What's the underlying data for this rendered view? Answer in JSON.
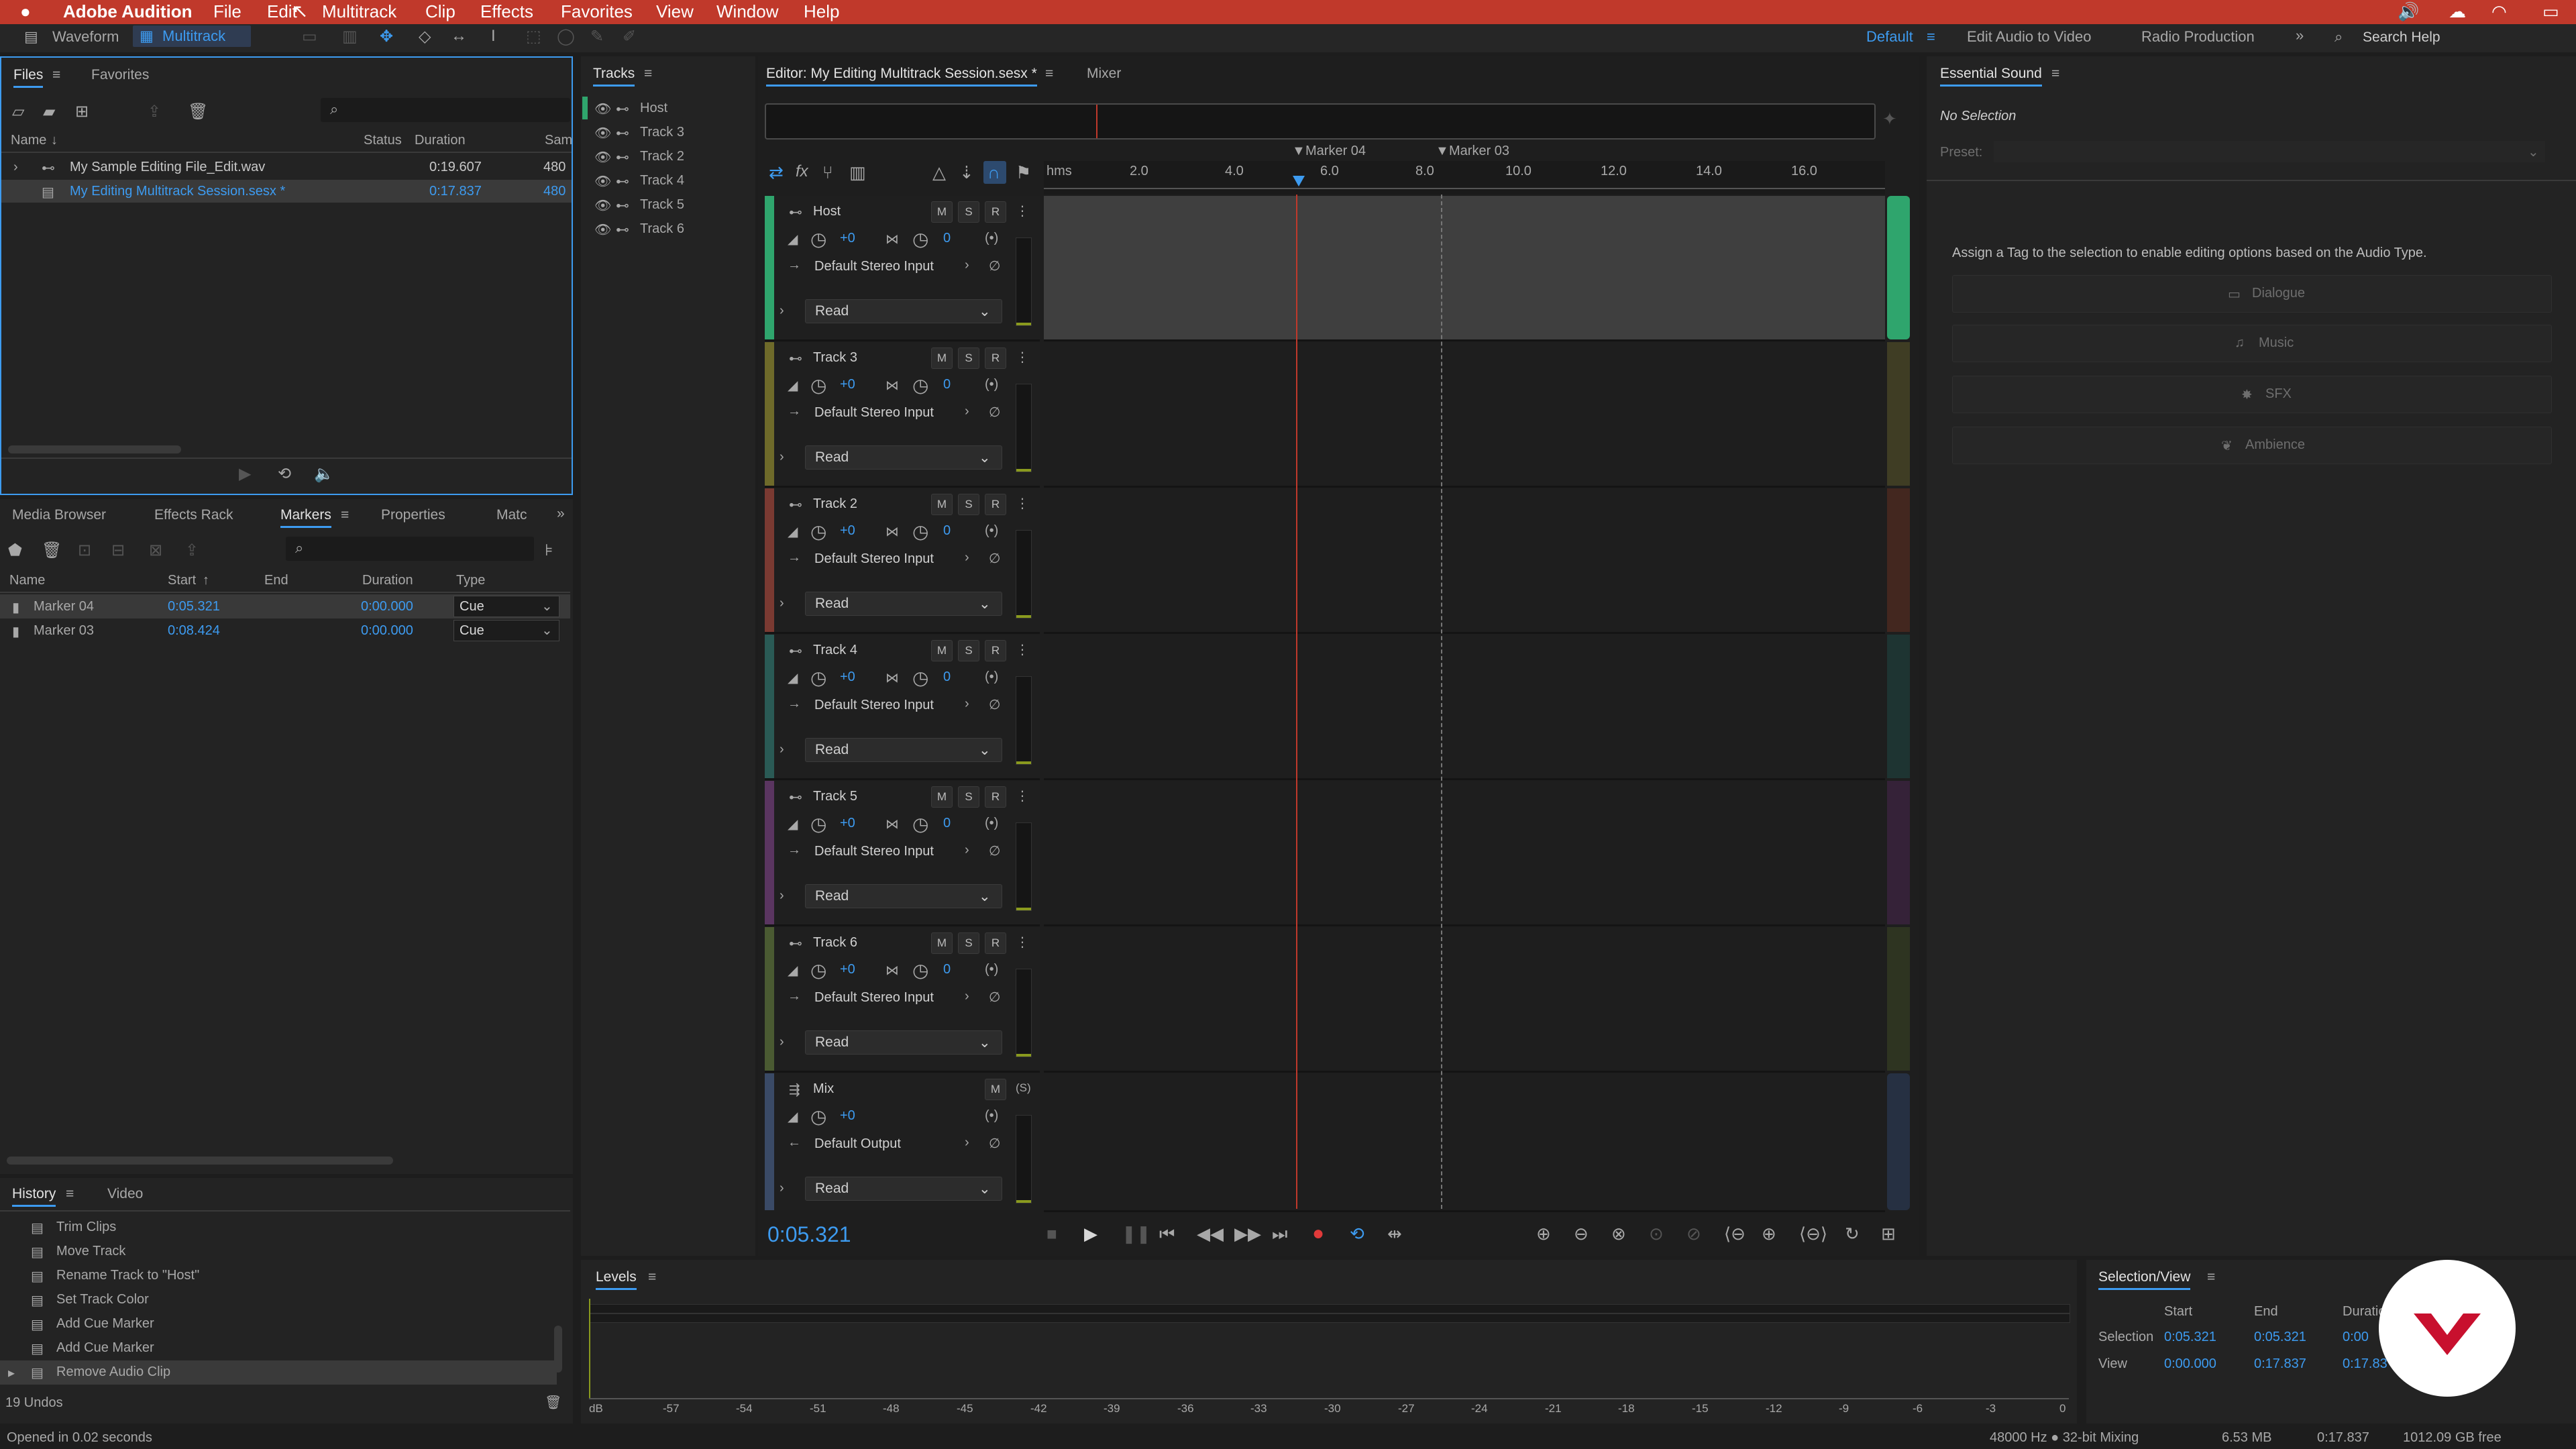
{
  "menubar": {
    "apple": "",
    "app_name": "Adobe Audition",
    "items": [
      "File",
      "Edit",
      "Multitrack",
      "Clip",
      "Effects",
      "Favorites",
      "View",
      "Window",
      "Help"
    ]
  },
  "workspace_bar": {
    "view_tabs": [
      "Waveform",
      "Multitrack"
    ],
    "workspaces": [
      "Default",
      "Edit Audio to Video",
      "Radio Production"
    ],
    "search_placeholder": "Search Help"
  },
  "files_panel": {
    "tabs": [
      "Files",
      "Favorites"
    ],
    "columns": [
      "Name",
      "Status",
      "Duration",
      "Sam"
    ],
    "rows": [
      {
        "name": "My Sample Editing File_Edit.wav",
        "status": "",
        "duration": "0:19.607",
        "rate": "480"
      },
      {
        "name": "My Editing Multitrack Session.sesx *",
        "status": "",
        "duration": "0:17.837",
        "rate": "480"
      }
    ]
  },
  "markers_panel": {
    "tabs": [
      "Media Browser",
      "Effects Rack",
      "Markers",
      "Properties",
      "Matc"
    ],
    "columns": [
      "Name",
      "Start",
      "End",
      "Duration",
      "Type"
    ],
    "rows": [
      {
        "name": "Marker 04",
        "start": "0:05.321",
        "end": "",
        "duration": "0:00.000",
        "type": "Cue"
      },
      {
        "name": "Marker 03",
        "start": "0:08.424",
        "end": "",
        "duration": "0:00.000",
        "type": "Cue"
      }
    ]
  },
  "history_panel": {
    "tabs": [
      "History",
      "Video"
    ],
    "items": [
      "Trim Clips",
      "Move Track",
      "Rename Track to \"Host\"",
      "Set Track Color",
      "Add Cue Marker",
      "Add Cue Marker",
      "Remove Audio Clip"
    ],
    "undos": "19 Undos"
  },
  "status_bar": {
    "message": "Opened in 0.02 seconds",
    "sample_info": "48000 Hz ● 32-bit Mixing",
    "mem": "6.53 MB",
    "duration": "0:17.837",
    "free": "1012.09 GB free"
  },
  "tracks_panel": {
    "title": "Tracks",
    "items": [
      "Host",
      "Track 3",
      "Track 2",
      "Track 4",
      "Track 5",
      "Track 6"
    ]
  },
  "editor": {
    "tabs": [
      "Editor: My Editing Multitrack Session.sesx *",
      "Mixer"
    ],
    "ruler_unit": "hms",
    "ruler_ticks": [
      "2.0",
      "4.0",
      "6.0",
      "8.0",
      "10.0",
      "12.0",
      "14.0",
      "16.0"
    ],
    "markers": [
      "Marker 04",
      "Marker 03"
    ],
    "time": "0:05.321",
    "tracks": [
      {
        "name": "Host",
        "vol": "+0",
        "pan": "0",
        "input": "Default Stereo Input",
        "mode": "Read",
        "color": "#2fa56d"
      },
      {
        "name": "Track 3",
        "vol": "+0",
        "pan": "0",
        "input": "Default Stereo Input",
        "mode": "Read",
        "color": "#6e6a2a"
      },
      {
        "name": "Track 2",
        "vol": "+0",
        "pan": "0",
        "input": "Default Stereo Input",
        "mode": "Read",
        "color": "#7a3a32"
      },
      {
        "name": "Track 4",
        "vol": "+0",
        "pan": "0",
        "input": "Default Stereo Input",
        "mode": "Read",
        "color": "#2a5a55"
      },
      {
        "name": "Track 5",
        "vol": "+0",
        "pan": "0",
        "input": "Default Stereo Input",
        "mode": "Read",
        "color": "#5a3560"
      },
      {
        "name": "Track 6",
        "vol": "+0",
        "pan": "0",
        "input": "Default Stereo Input",
        "mode": "Read",
        "color": "#4a5a32"
      }
    ],
    "mix": {
      "name": "Mix",
      "vol": "+0",
      "output": "Default Output",
      "mode": "Read",
      "color": "#3a4a66"
    },
    "btn_m": "M",
    "btn_s": "S",
    "btn_r": "R"
  },
  "levels_panel": {
    "title": "Levels",
    "scale": [
      "dB",
      "-57",
      "-54",
      "-51",
      "-48",
      "-45",
      "-42",
      "-39",
      "-36",
      "-33",
      "-30",
      "-27",
      "-24",
      "-21",
      "-18",
      "-15",
      "-12",
      "-9",
      "-6",
      "-3",
      "0"
    ]
  },
  "selection_view": {
    "title": "Selection/View",
    "columns": [
      "Start",
      "End",
      "Duration"
    ],
    "selection": {
      "label": "Selection",
      "start": "0:05.321",
      "end": "0:05.321",
      "duration": "0:00"
    },
    "view": {
      "label": "View",
      "start": "0:00.000",
      "end": "0:17.837",
      "duration": "0:17.83"
    }
  },
  "essential_sound": {
    "title": "Essential Sound",
    "selection": "No Selection",
    "preset_label": "Preset:",
    "hint": "Assign a Tag to the selection to enable editing options based on the Audio Type.",
    "buttons": [
      "Dialogue",
      "Music",
      "SFX",
      "Ambience"
    ]
  }
}
